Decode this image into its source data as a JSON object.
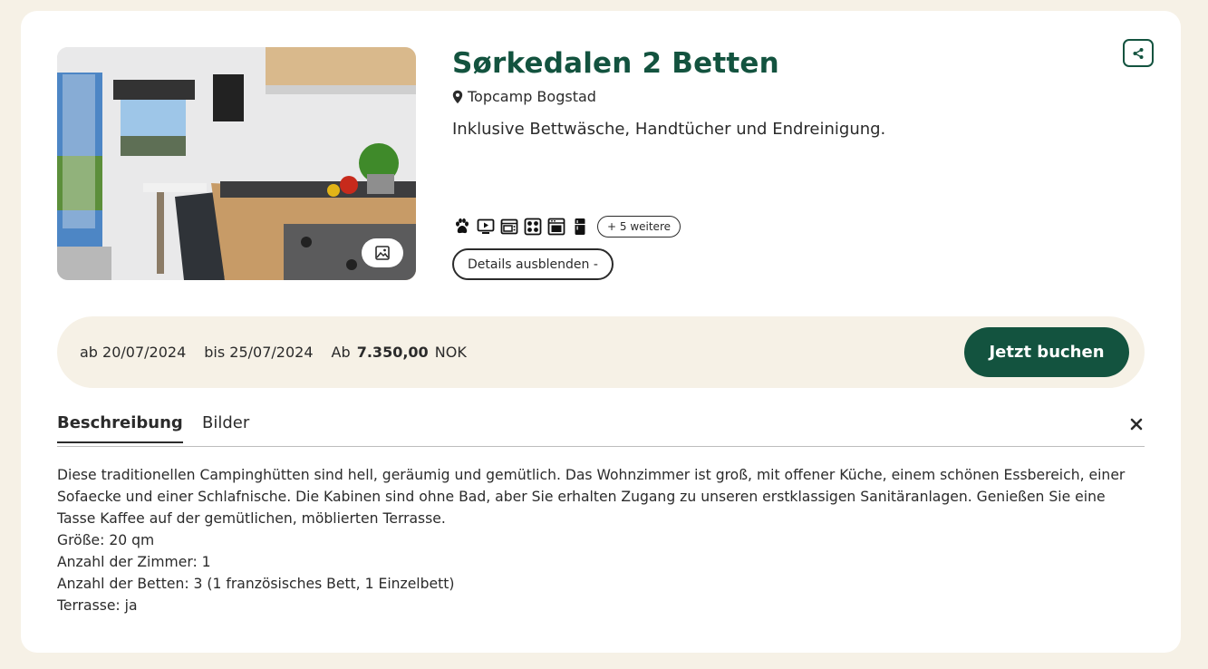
{
  "listing": {
    "title": "Sørkedalen 2 Betten",
    "location": "Topcamp Bogstad",
    "subtitle": "Inklusive Bettwäsche, Handtücher und Endreinigung.",
    "amenities": [
      "paw-icon",
      "tv-icon",
      "microwave-icon",
      "stove-icon",
      "oven-icon",
      "fridge-icon"
    ],
    "more_amenities": "+ 5 weitere",
    "details_toggle": "Details ausblenden -"
  },
  "booking": {
    "from": "ab 20/07/2024",
    "to": "bis 25/07/2024",
    "price_prefix": "Ab",
    "price_amount": "7.350,00",
    "currency": "NOK",
    "book_label": "Jetzt buchen"
  },
  "tabs": [
    {
      "label": "Beschreibung",
      "active": true
    },
    {
      "label": "Bilder",
      "active": false
    }
  ],
  "description": {
    "text": "Diese traditionellen Campinghütten sind hell, geräumig und gemütlich. Das Wohnzimmer ist groß, mit offener Küche, einem schönen Essbereich, einer Sofaecke und einer Schlafnische. Die Kabinen sind ohne Bad, aber Sie erhalten Zugang zu unseren erstklassigen Sanitäranlagen. Genießen Sie eine Tasse Kaffee auf der gemütlichen, möblierten Terrasse.",
    "size": "Größe: 20 qm",
    "rooms": "Anzahl der Zimmer: 1",
    "beds": "Anzahl der Betten: 3 (1 französisches Bett, 1 Einzelbett)",
    "terrace": "Terrasse: ja"
  },
  "colors": {
    "brand": "#13533f",
    "page_bg": "#f6f1e6",
    "text": "#2b2b2b"
  }
}
